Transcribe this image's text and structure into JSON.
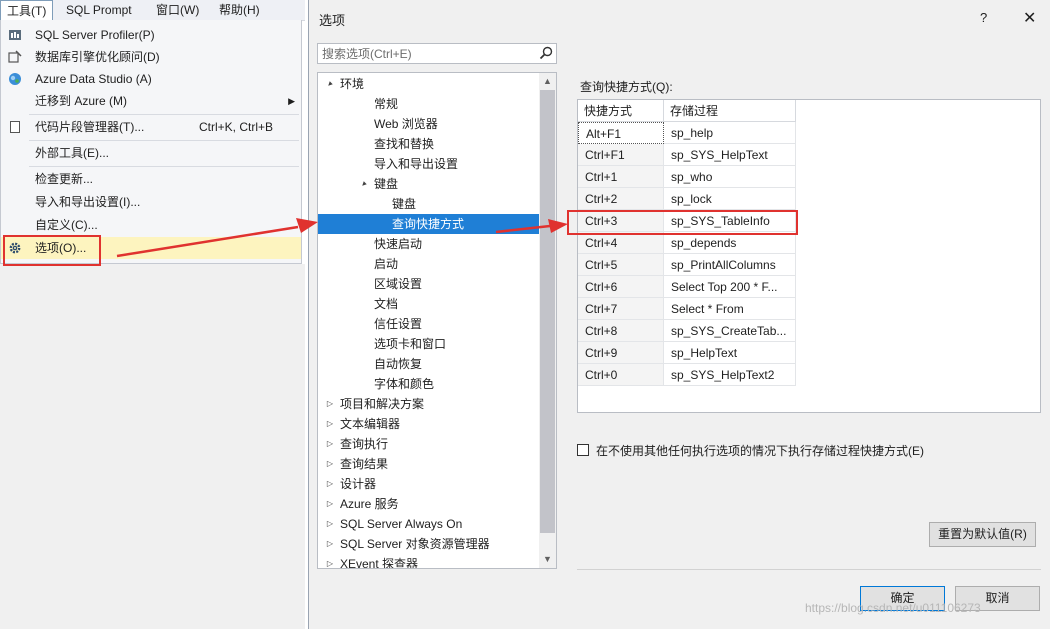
{
  "menubar": {
    "items": [
      "工具(T)",
      "SQL Prompt",
      "窗口(W)",
      "帮助(H)"
    ]
  },
  "tools_menu": {
    "items": [
      {
        "label": "SQL Server Profiler(P)",
        "icon": "profiler-icon"
      },
      {
        "label": "数据库引擎优化顾问(D)",
        "icon": "tuning-advisor-icon"
      },
      {
        "label": "Azure Data Studio (A)",
        "icon": "azure-data-studio-icon"
      },
      {
        "label": "迁移到 Azure (M)",
        "icon": "",
        "submenu": true
      },
      {
        "label": "代码片段管理器(T)...",
        "shortcut": "Ctrl+K, Ctrl+B",
        "icon": "snippet-icon"
      },
      {
        "label": "外部工具(E)...",
        "icon": ""
      },
      {
        "label": "检查更新...",
        "icon": ""
      },
      {
        "label": "导入和导出设置(I)...",
        "icon": ""
      },
      {
        "label": "自定义(C)...",
        "icon": ""
      },
      {
        "label": "选项(O)...",
        "icon": "gear-icon",
        "highlighted": true
      }
    ]
  },
  "dialog": {
    "title": "选项",
    "help": "?",
    "close": "✕",
    "search_placeholder": "搜索选项(Ctrl+E)",
    "tree": [
      {
        "label": "环境",
        "level": 0,
        "toggle": "▲"
      },
      {
        "label": "常规",
        "level": 1
      },
      {
        "label": "Web 浏览器",
        "level": 1
      },
      {
        "label": "查找和替换",
        "level": 1
      },
      {
        "label": "导入和导出设置",
        "level": 1
      },
      {
        "label": "键盘",
        "level": 1,
        "toggle": "▲"
      },
      {
        "label": "键盘",
        "level": 2
      },
      {
        "label": "查询快捷方式",
        "level": 2,
        "selected": true
      },
      {
        "label": "快速启动",
        "level": 1
      },
      {
        "label": "启动",
        "level": 1
      },
      {
        "label": "区域设置",
        "level": 1
      },
      {
        "label": "文档",
        "level": 1
      },
      {
        "label": "信任设置",
        "level": 1
      },
      {
        "label": "选项卡和窗口",
        "level": 1
      },
      {
        "label": "自动恢复",
        "level": 1
      },
      {
        "label": "字体和颜色",
        "level": 1
      },
      {
        "label": "项目和解决方案",
        "level": 0,
        "toggle": "▷"
      },
      {
        "label": "文本编辑器",
        "level": 0,
        "toggle": "▷"
      },
      {
        "label": "查询执行",
        "level": 0,
        "toggle": "▷"
      },
      {
        "label": "查询结果",
        "level": 0,
        "toggle": "▷"
      },
      {
        "label": "设计器",
        "level": 0,
        "toggle": "▷"
      },
      {
        "label": "Azure 服务",
        "level": 0,
        "toggle": "▷"
      },
      {
        "label": "SQL Server Always On",
        "level": 0,
        "toggle": "▷"
      },
      {
        "label": "SQL Server 对象资源管理器",
        "level": 0,
        "toggle": "▷"
      },
      {
        "label": "XEvent 探查器",
        "level": 0,
        "toggle": "▷"
      }
    ],
    "shortcuts_label": "查询快捷方式(Q):",
    "grid_headers": [
      "快捷方式",
      "存储过程"
    ],
    "grid_rows": [
      [
        "Alt+F1",
        "sp_help"
      ],
      [
        "Ctrl+F1",
        "sp_SYS_HelpText"
      ],
      [
        "Ctrl+1",
        "sp_who"
      ],
      [
        "Ctrl+2",
        "sp_lock"
      ],
      [
        "Ctrl+3",
        "sp_SYS_TableInfo"
      ],
      [
        "Ctrl+4",
        "sp_depends"
      ],
      [
        "Ctrl+5",
        "sp_PrintAllColumns"
      ],
      [
        "Ctrl+6",
        "Select Top 200 * F..."
      ],
      [
        "Ctrl+7",
        "Select * From"
      ],
      [
        "Ctrl+8",
        "sp_SYS_CreateTab..."
      ],
      [
        "Ctrl+9",
        "sp_HelpText"
      ],
      [
        "Ctrl+0",
        "sp_SYS_HelpText2"
      ]
    ],
    "checkbox_label": "在不使用其他任何执行选项的情况下执行存储过程快捷方式(E)",
    "reset_button": "重置为默认值(R)",
    "ok_button": "确定",
    "cancel_button": "取消"
  },
  "watermark": "https://blog.csdn.net/u011106273",
  "colors": {
    "selection": "#1f7fd6",
    "highlight": "#fdf4bf",
    "annotation": "#e0322f"
  }
}
